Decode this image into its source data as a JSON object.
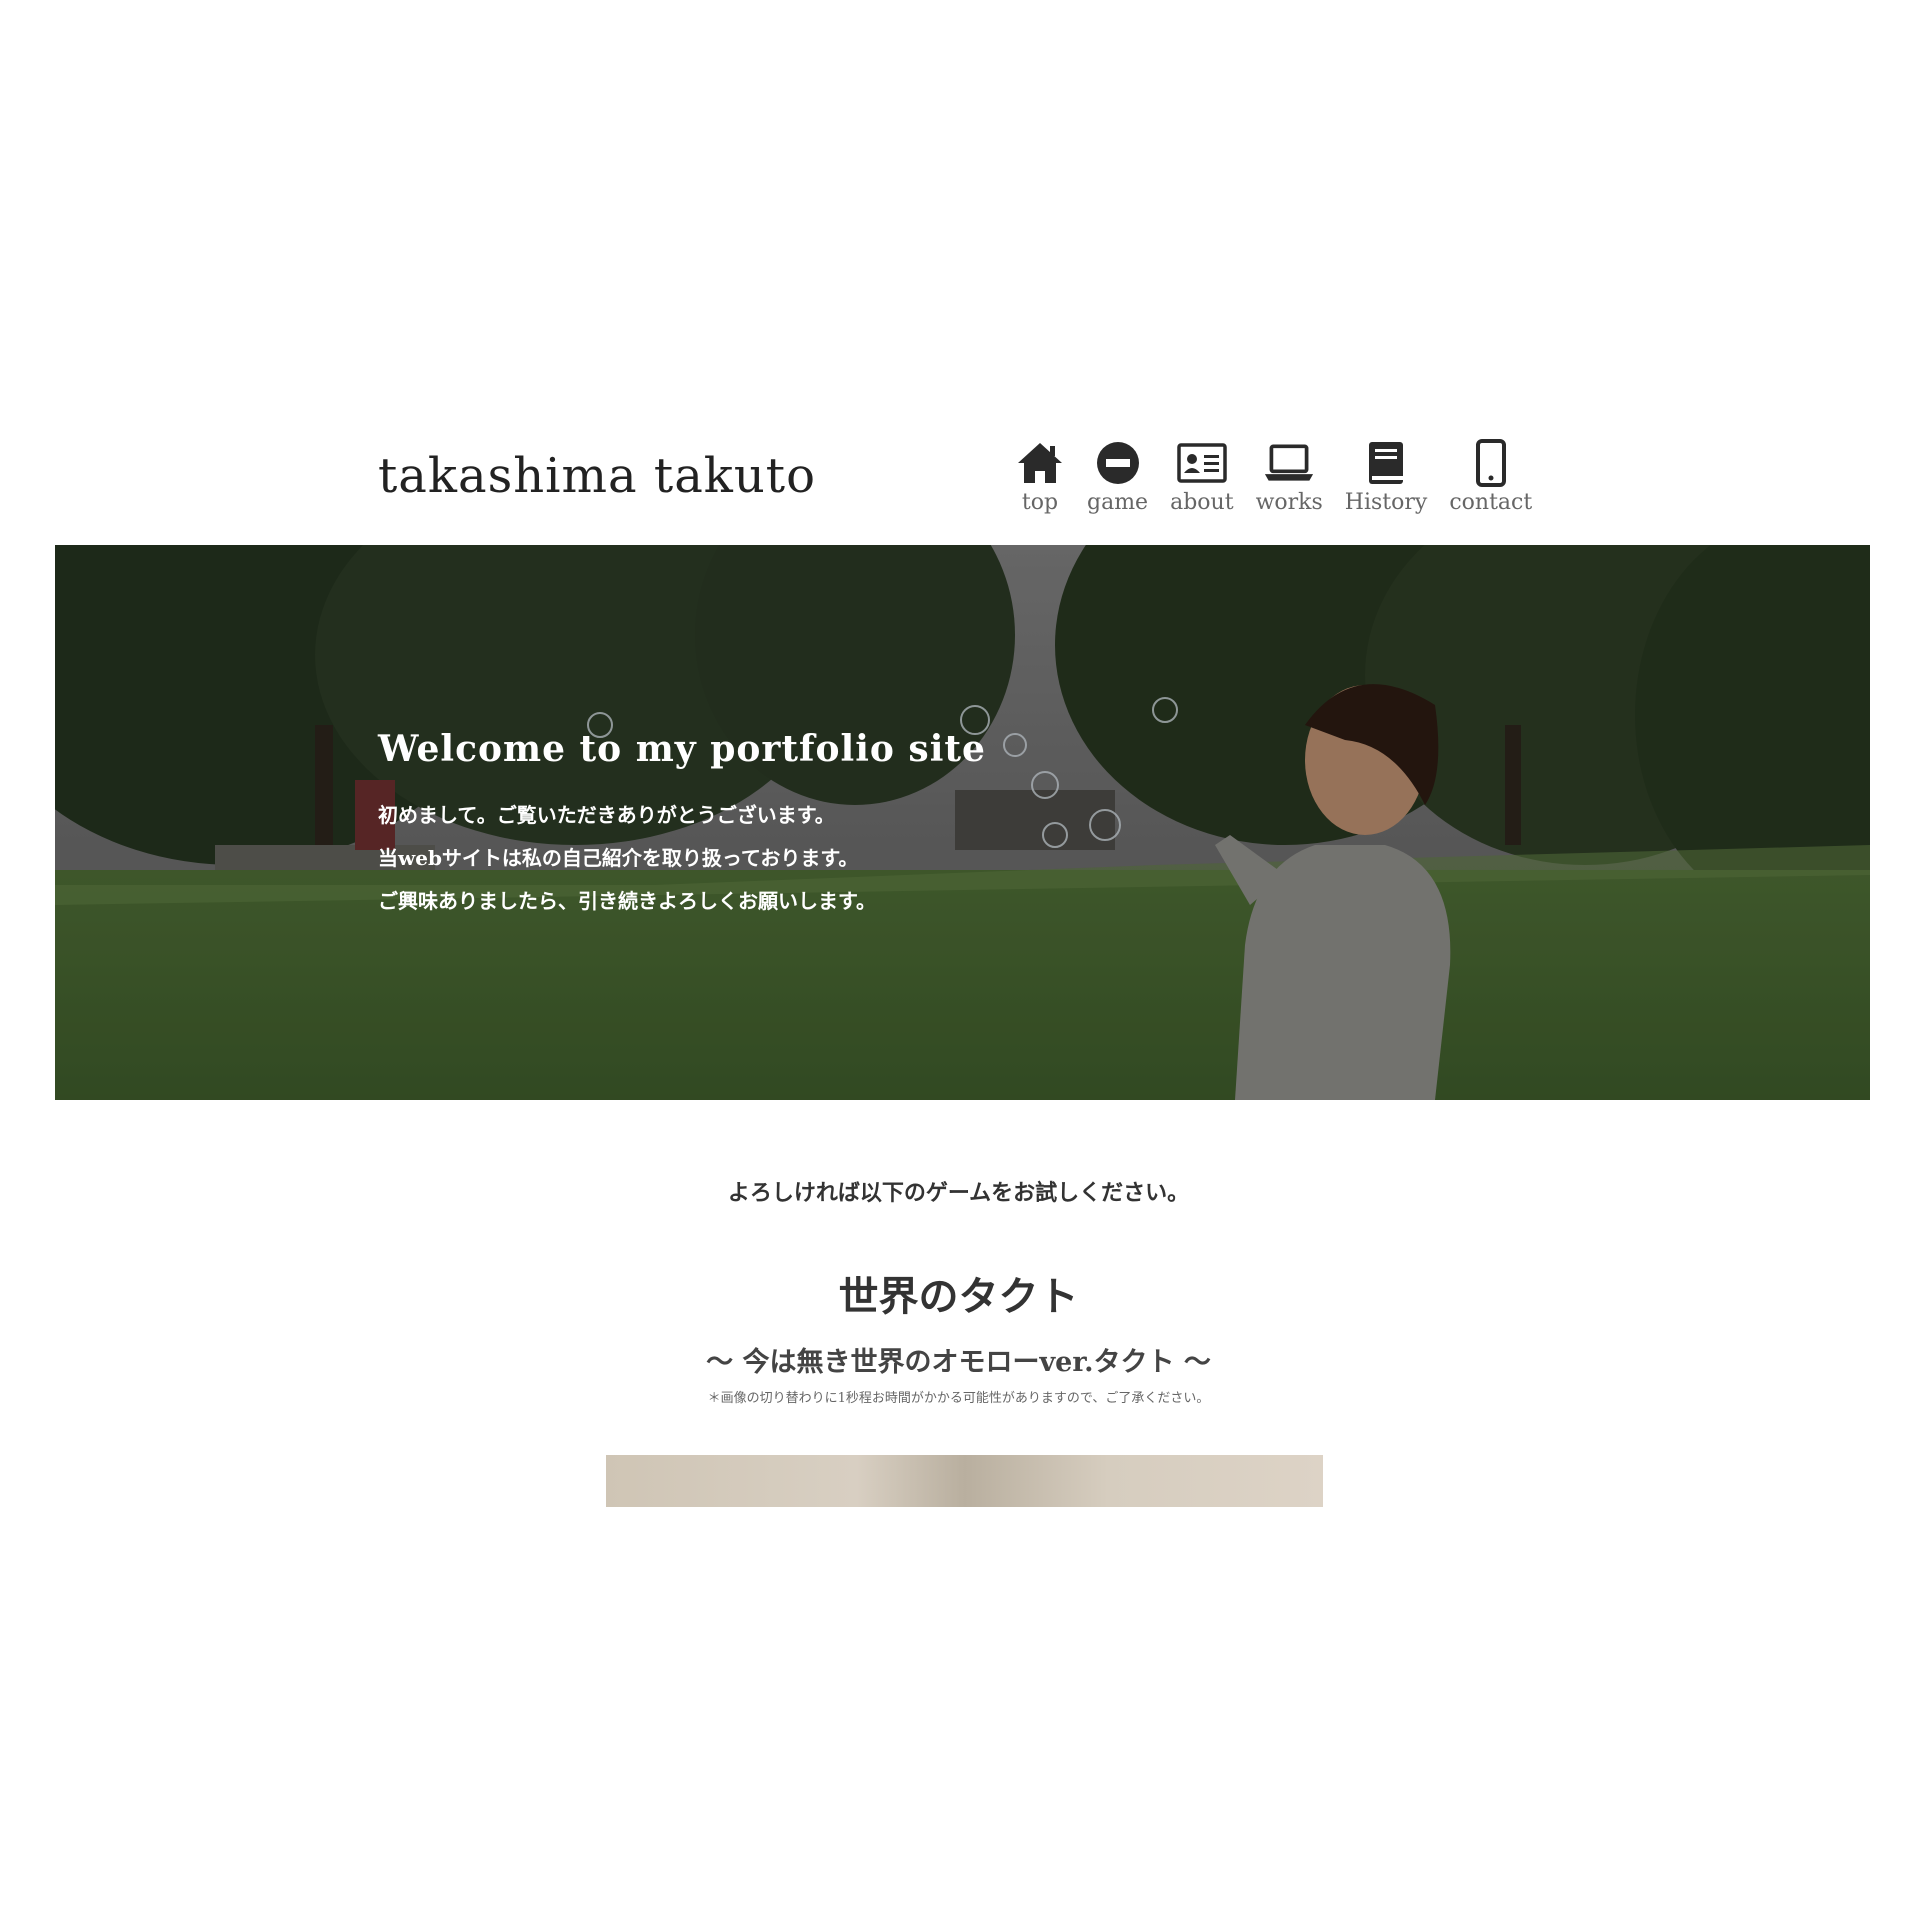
{
  "header": {
    "site_title": "takashima takuto",
    "nav": [
      {
        "label": "top",
        "icon": "home-icon"
      },
      {
        "label": "game",
        "icon": "minus-circle-icon"
      },
      {
        "label": "about",
        "icon": "id-card-icon"
      },
      {
        "label": "works",
        "icon": "laptop-icon"
      },
      {
        "label": "History",
        "icon": "book-icon"
      },
      {
        "label": "contact",
        "icon": "mobile-phone-icon"
      }
    ]
  },
  "hero": {
    "title": "Welcome to my portfolio site",
    "lines": [
      "初めまして。ご覧いただきありがとうございます。",
      "当webサイトは私の自己紹介を取り扱っております。",
      "ご興味ありましたら、引き続きよろしくお願いします。"
    ]
  },
  "game_section": {
    "intro": "よろしければ以下のゲームをお試しください。",
    "title": "世界のタクト",
    "subtitle": "〜 今は無き世界のオモローver.タクト 〜",
    "note": "＊画像の切り替わりに1秒程お時間がかかる可能性がありますので、ご了承ください。"
  },
  "colors": {
    "icon": "#2a2a2a",
    "hero_text": "#ffffff",
    "body_text": "#333333"
  }
}
